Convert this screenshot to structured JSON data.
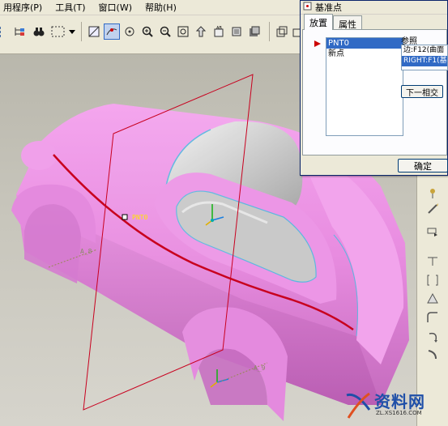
{
  "menubar": {
    "items": [
      "用程序(P)",
      "工具(T)",
      "窗口(W)",
      "帮助(H)"
    ]
  },
  "dialog": {
    "title": "基准点",
    "tabs": [
      "放置",
      "属性"
    ],
    "points": [
      "PNT0",
      "新点"
    ],
    "reference_label": "参照",
    "references": [
      "边:F12(曲面",
      "RIGHT:F1(基"
    ],
    "next_button": "下一相交",
    "ok_button": "确定"
  },
  "viewport": {
    "point_label": "PNT0",
    "axis_labels": [
      "A_8",
      "A_9"
    ]
  },
  "watermark": {
    "text": "资料网",
    "url": "ZL.XS1616.COM"
  },
  "colors": {
    "car_body": "#e88ce0",
    "car_shadow": "#c46bbd",
    "plane_edge": "#c8001e",
    "curve": "#c8001e",
    "window_edge": "#5bb8e0"
  }
}
